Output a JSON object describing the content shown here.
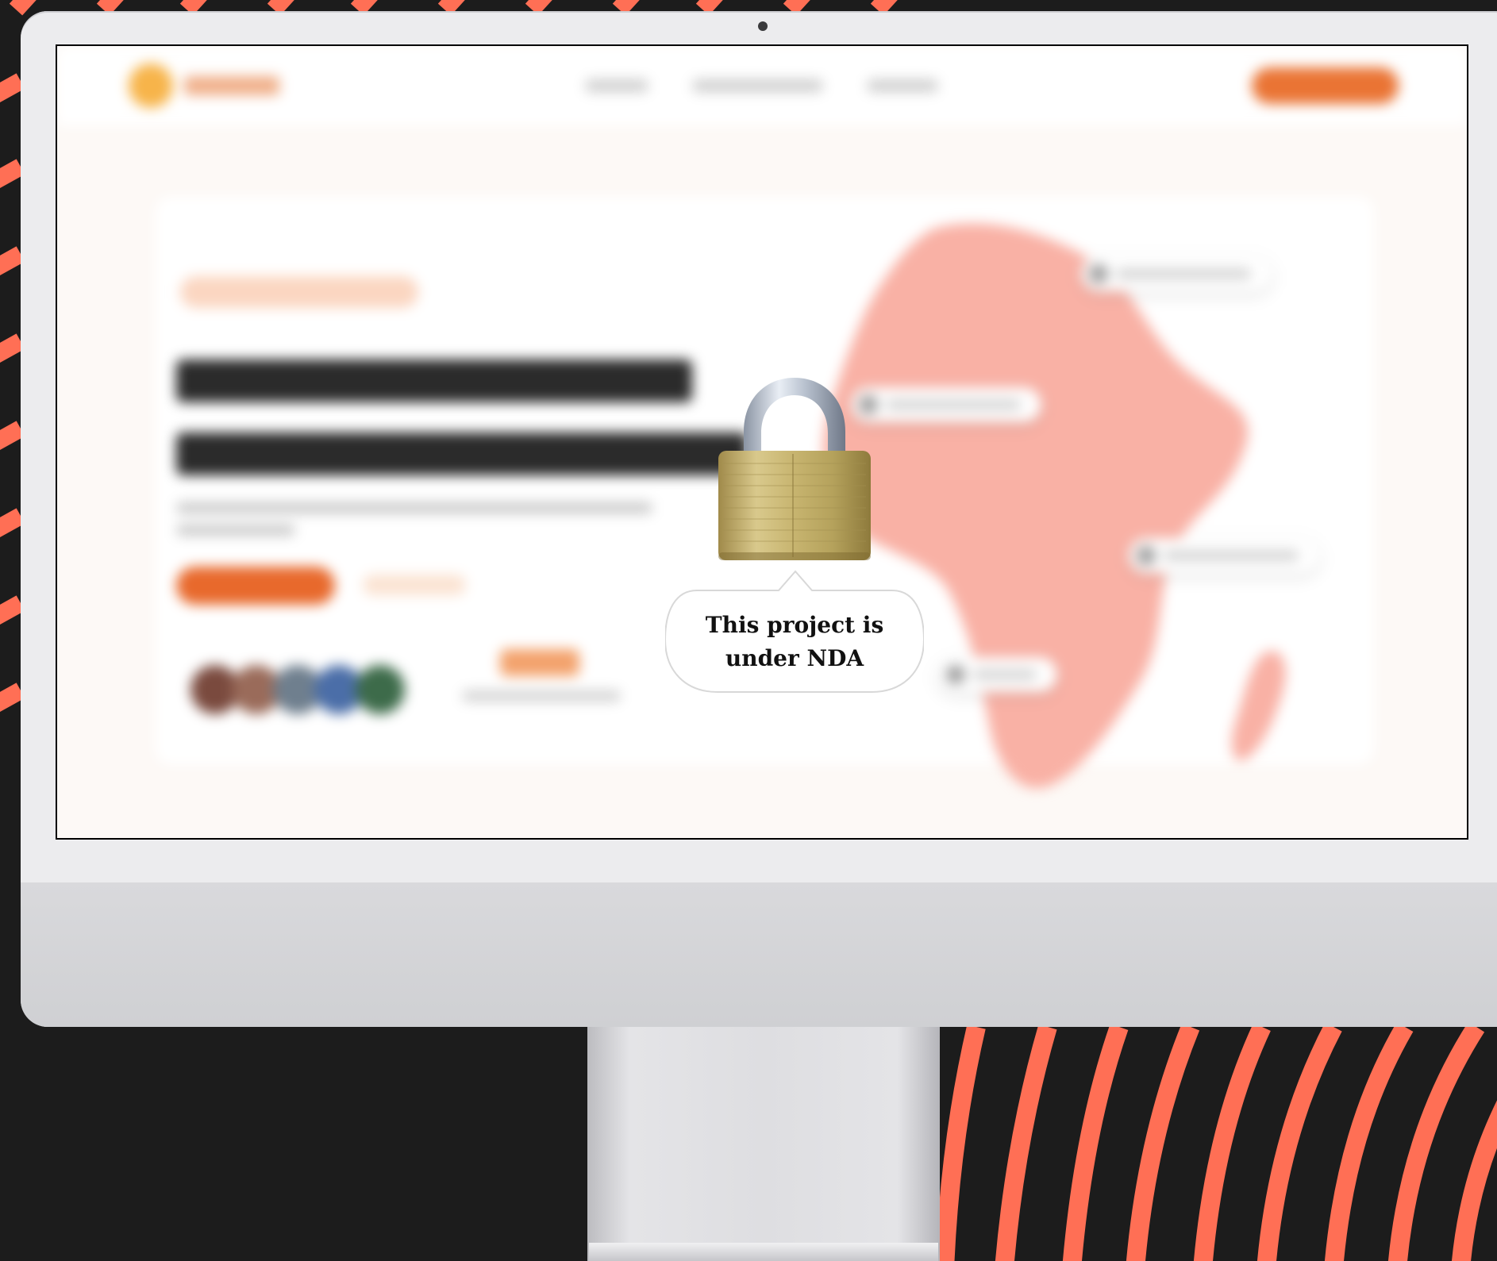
{
  "overlay": {
    "message": "This project is under NDA",
    "icon": "lock-icon"
  },
  "colors": {
    "background": "#1c1c1c",
    "stripe_accent": "#ff6f55",
    "brand_orange": "#e8692c",
    "device_body": "#ececee",
    "map_fill": "#f9b1a5"
  }
}
